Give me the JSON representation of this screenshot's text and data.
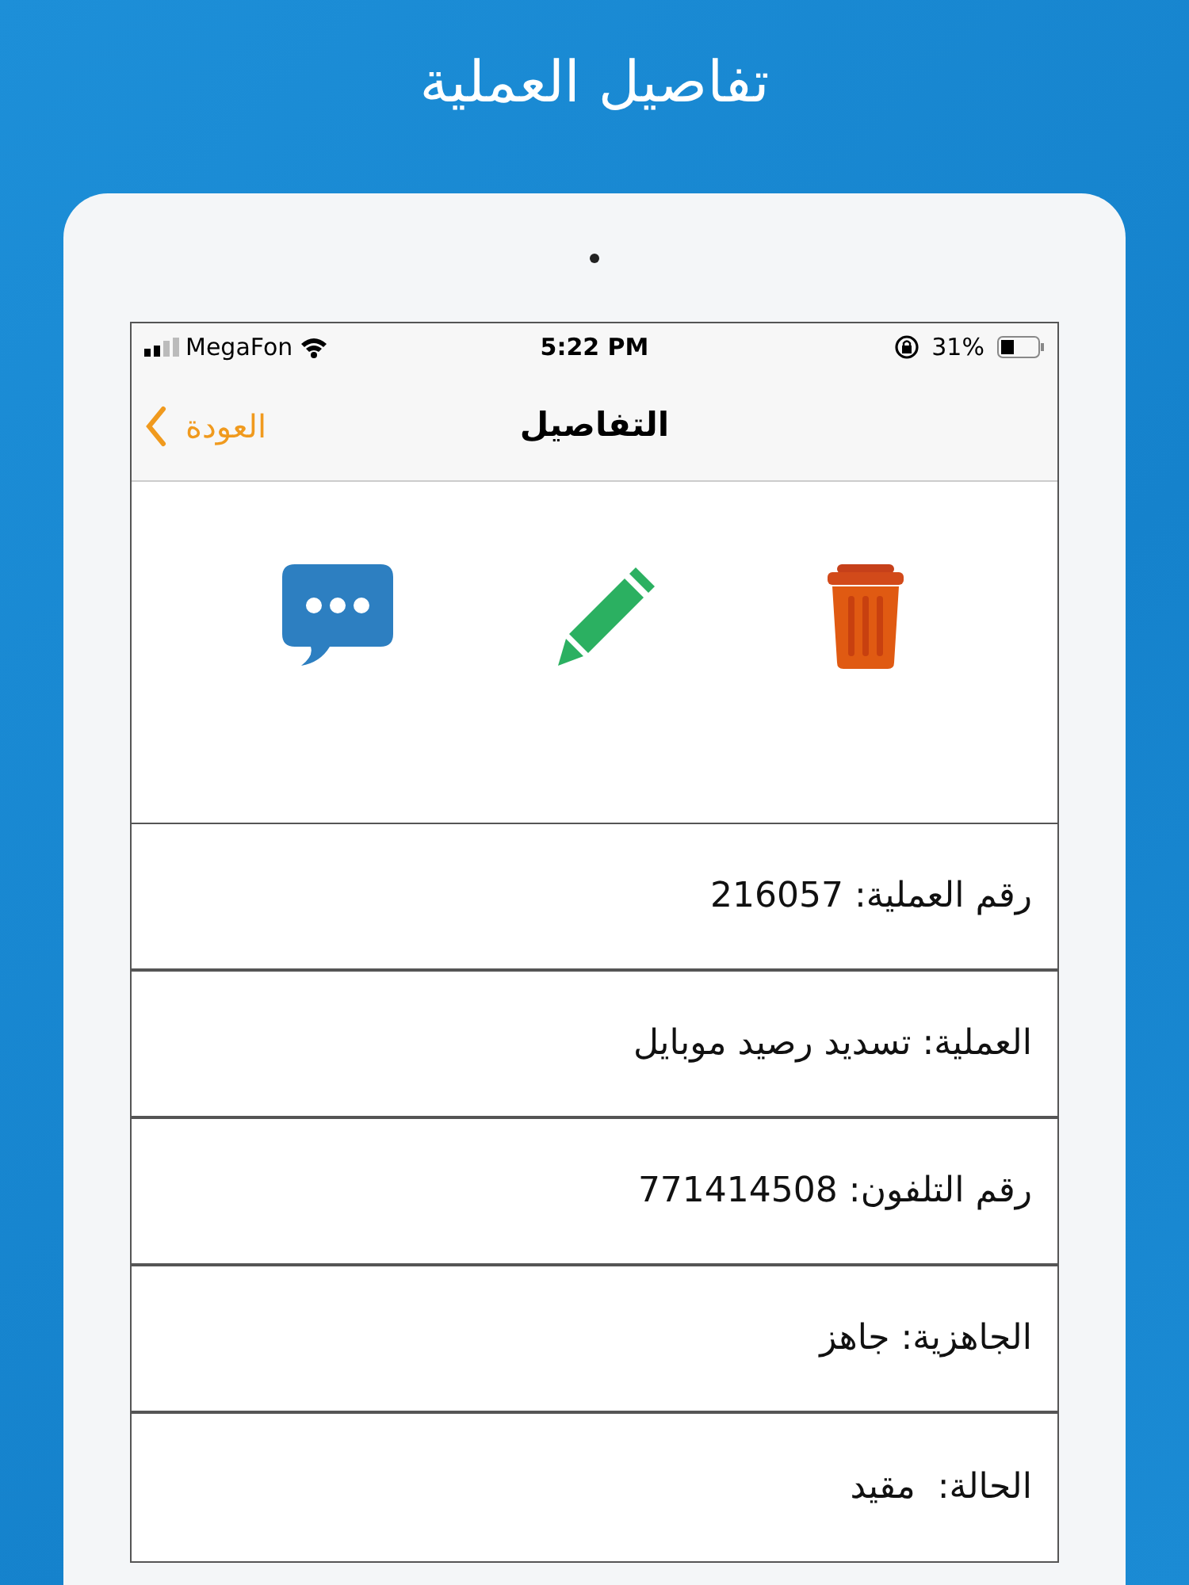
{
  "headline": "تفاصيل العملية",
  "status_bar": {
    "carrier": "MegaFon",
    "time": "5:22 PM",
    "battery": "31%"
  },
  "nav_bar": {
    "back": "العودة",
    "title": "التفاصيل"
  },
  "actions": [
    {
      "kind": "delete"
    },
    {
      "kind": "edit"
    },
    {
      "kind": "message"
    }
  ],
  "rows": [
    {
      "text": "رقم العملية: 216057"
    },
    {
      "text": "العملية: تسديد رصيد موبايل"
    },
    {
      "text": "رقم التلفون: 771414508"
    },
    {
      "text": "الجاهزية: جاهز"
    },
    {
      "text": "الحالة:  مقيد"
    }
  ]
}
